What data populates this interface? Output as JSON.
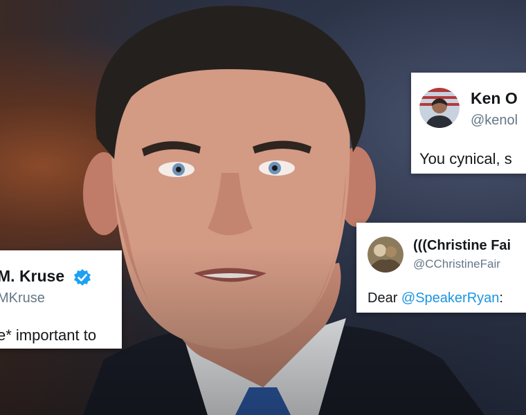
{
  "tweets": {
    "ken": {
      "name": "Ken O",
      "handle": "@kenol",
      "text": "You cynical, s",
      "avatar_icon": "profile-photo-icon"
    },
    "christine": {
      "name": "(((Christine Fai",
      "handle": "@CChristineFair",
      "text_prefix": "Dear ",
      "mention": "@SpeakerRyan",
      "text_suffix": ":",
      "avatar_icon": "profile-photo-icon"
    },
    "kruse": {
      "name": "M. Kruse",
      "handle": "MKruse",
      "text": "e* important to",
      "verified_icon": "verified-badge-icon"
    }
  },
  "colors": {
    "mention": "#1b95e0",
    "verified": "#1da1f2",
    "handle": "#657786",
    "tie": "#2f5fb0"
  }
}
